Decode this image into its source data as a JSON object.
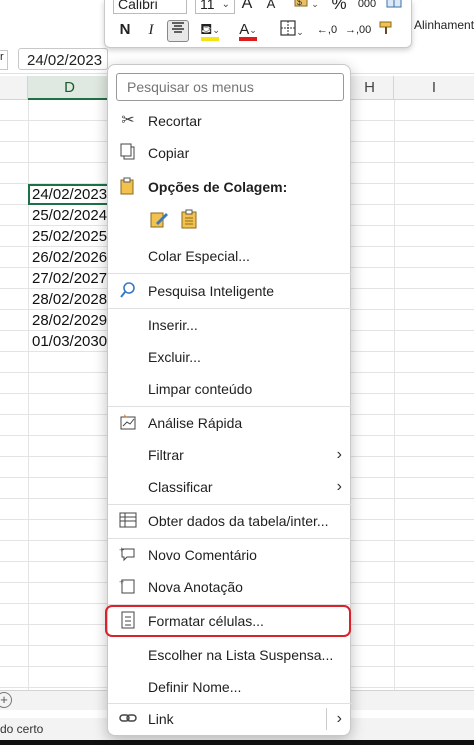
{
  "formula_bar": {
    "cell_value": "24/02/2023",
    "name_box_fragment": "r"
  },
  "columns": {
    "d": "D",
    "h": "H",
    "i": "I"
  },
  "cells": [
    "24/02/2023",
    "25/02/2024",
    "25/02/2025",
    "26/02/2026",
    "27/02/2027",
    "28/02/2028",
    "28/02/2029",
    "01/03/2030"
  ],
  "status_bar": {
    "text": "do certo"
  },
  "mini_toolbar": {
    "font_name": "Calibri",
    "font_size": "11",
    "bold": "N",
    "italic": "I",
    "grow_font": "A",
    "shrink_font": "A",
    "percent": "%",
    "thousands": "000",
    "decimal_inc": "←,0",
    "decimal_dec": "→,00",
    "fill_color": "#f5e31a",
    "font_color": "#e01b1b"
  },
  "ribbon_partial_label": "Alinhamento",
  "context_menu": {
    "search_placeholder": "Pesquisar os menus",
    "items": {
      "cut": "Recortar",
      "copy": "Copiar",
      "paste_options": "Opções de Colagem:",
      "paste_special": "Colar Especial...",
      "smart_lookup": "Pesquisa Inteligente",
      "insert": "Inserir...",
      "delete": "Excluir...",
      "clear_contents": "Limpar conteúdo",
      "quick_analysis": "Análise Rápida",
      "filter": "Filtrar",
      "sort": "Classificar",
      "get_data": "Obter dados da tabela/inter...",
      "new_comment": "Novo Comentário",
      "new_note": "Nova Anotação",
      "format_cells": "Formatar células...",
      "pick_list": "Escolher na Lista Suspensa...",
      "define_name": "Definir Nome...",
      "link": "Link"
    },
    "submenu_glyph": "›",
    "highlight_color": "#d9222a"
  }
}
